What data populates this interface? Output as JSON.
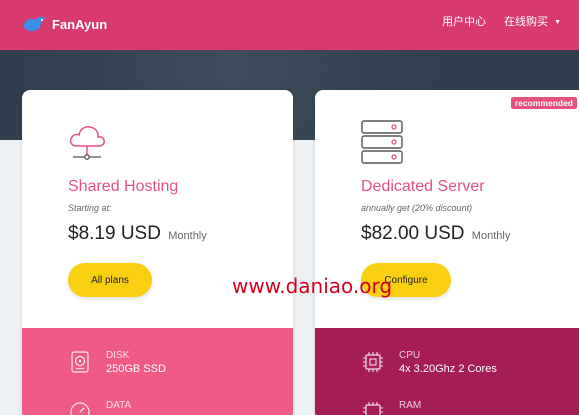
{
  "header": {
    "brand": "FanAyun",
    "nav": [
      {
        "label": "用户中心"
      },
      {
        "label": "在线购买",
        "has_dropdown": true
      }
    ],
    "colors": {
      "bar": "#d83a6f"
    }
  },
  "plans": [
    {
      "icon": "cloud-network-icon",
      "title": "Shared Hosting",
      "subtitle": "Starting at:",
      "price": "$8.19 USD",
      "period": "Monthly",
      "button": "All plans",
      "specs": [
        {
          "icon": "disk-icon",
          "label": "DISK",
          "value": "250GB SSD"
        },
        {
          "icon": "gauge-icon",
          "label": "DATA",
          "value": ""
        }
      ]
    },
    {
      "icon": "server-rack-icon",
      "badge": "recommended",
      "title": "Dedicated Server",
      "subtitle": "annually get (20% discount)",
      "price": "$82.00 USD",
      "period": "Monthly",
      "button": "Configure",
      "specs": [
        {
          "icon": "cpu-icon",
          "label": "CPU",
          "value": "4x 3.20Ghz 2 Cores"
        },
        {
          "icon": "ram-icon",
          "label": "RAM",
          "value": ""
        }
      ]
    }
  ],
  "watermark": "www.daniao.org",
  "colors": {
    "accent": "#e5527f",
    "button": "#f9cf12",
    "specs_left": "#ef5a89",
    "specs_right": "#a51d57"
  }
}
